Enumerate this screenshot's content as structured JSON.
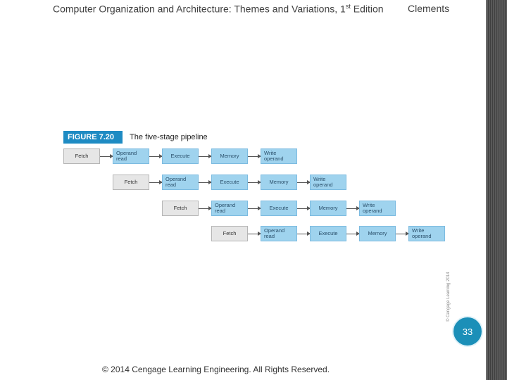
{
  "header": {
    "course_title": "Computer Organization and Architecture: Themes and Variations, 1",
    "course_title_sup": "st",
    "course_title_end": " Edition",
    "author": "Clements"
  },
  "figure": {
    "tag": "FIGURE 7.20",
    "title": "The five-stage pipeline",
    "credit": "© Cengage Learning 2014",
    "rows": [
      [
        "Fetch",
        "Operand read",
        "Execute",
        "Memory",
        "Write operand"
      ],
      [
        "Fetch",
        "Operand read",
        "Execute",
        "Memory",
        "Write operand"
      ],
      [
        "Fetch",
        "Operand read",
        "Execute",
        "Memory",
        "Write operand"
      ],
      [
        "Fetch",
        "Operand read",
        "Execute",
        "Memory",
        "Write operand"
      ]
    ]
  },
  "page_number": "33",
  "footer": "© 2014 Cengage Learning Engineering. All Rights Reserved."
}
